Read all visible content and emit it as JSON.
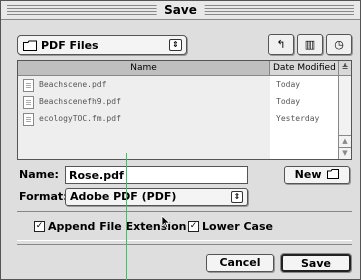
{
  "dialog": {
    "title": "Save"
  },
  "location": {
    "label": "PDF Files",
    "arrows": "⇕"
  },
  "nav": {
    "folder_btn": "↰",
    "desktop_btn": "▥",
    "recent_btn": "◷"
  },
  "list": {
    "col_name": "Name",
    "col_date": "Date Modified",
    "sort_indicator": "≜",
    "rows": [
      {
        "name": "Beachscene.pdf",
        "date": "Today"
      },
      {
        "name": "Beachscenefh9.pdf",
        "date": "Today"
      },
      {
        "name": "ecologyTOC.fm.pdf",
        "date": "Yesterday"
      }
    ]
  },
  "name_field": {
    "label": "Name:",
    "value": "Rose.pdf"
  },
  "new_button": {
    "label": "New",
    "icon": "folder-icon"
  },
  "format": {
    "label": "Format:",
    "value": "Adobe PDF (PDF)",
    "arrows": "⇕"
  },
  "options": {
    "append_ext": {
      "label": "Append File Extension",
      "checked": true
    },
    "lower_case": {
      "label": "Lower Case",
      "checked": true
    }
  },
  "buttons": {
    "cancel": "Cancel",
    "save": "Save"
  },
  "colors": {
    "guide_line": "#39c46a"
  }
}
